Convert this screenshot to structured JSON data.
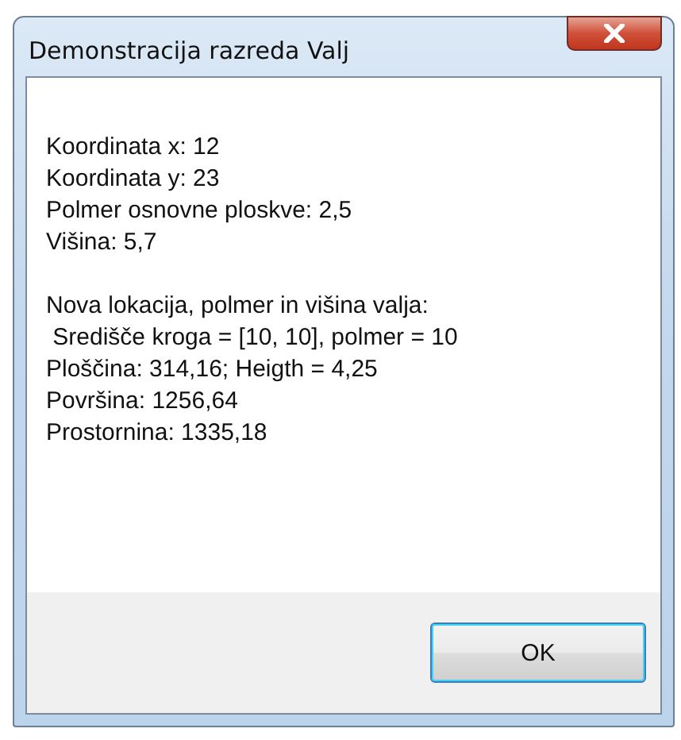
{
  "window": {
    "title": "Demonstracija razreda Valj"
  },
  "message": {
    "paragraphs": [
      [
        "Koordinata x: 12",
        "Koordinata y: 23",
        "Polmer osnovne ploskve: 2,5",
        "Višina: 5,7"
      ],
      [
        "Nova lokacija, polmer in višina valja:",
        " Središče kroga = [10, 10], polmer = 10",
        "Ploščina: 314,16; Heigth = 4,25",
        "Površina: 1256,64",
        "Prostornina: 1335,18"
      ]
    ]
  },
  "buttons": [
    {
      "label": "OK",
      "kind": "default"
    }
  ]
}
